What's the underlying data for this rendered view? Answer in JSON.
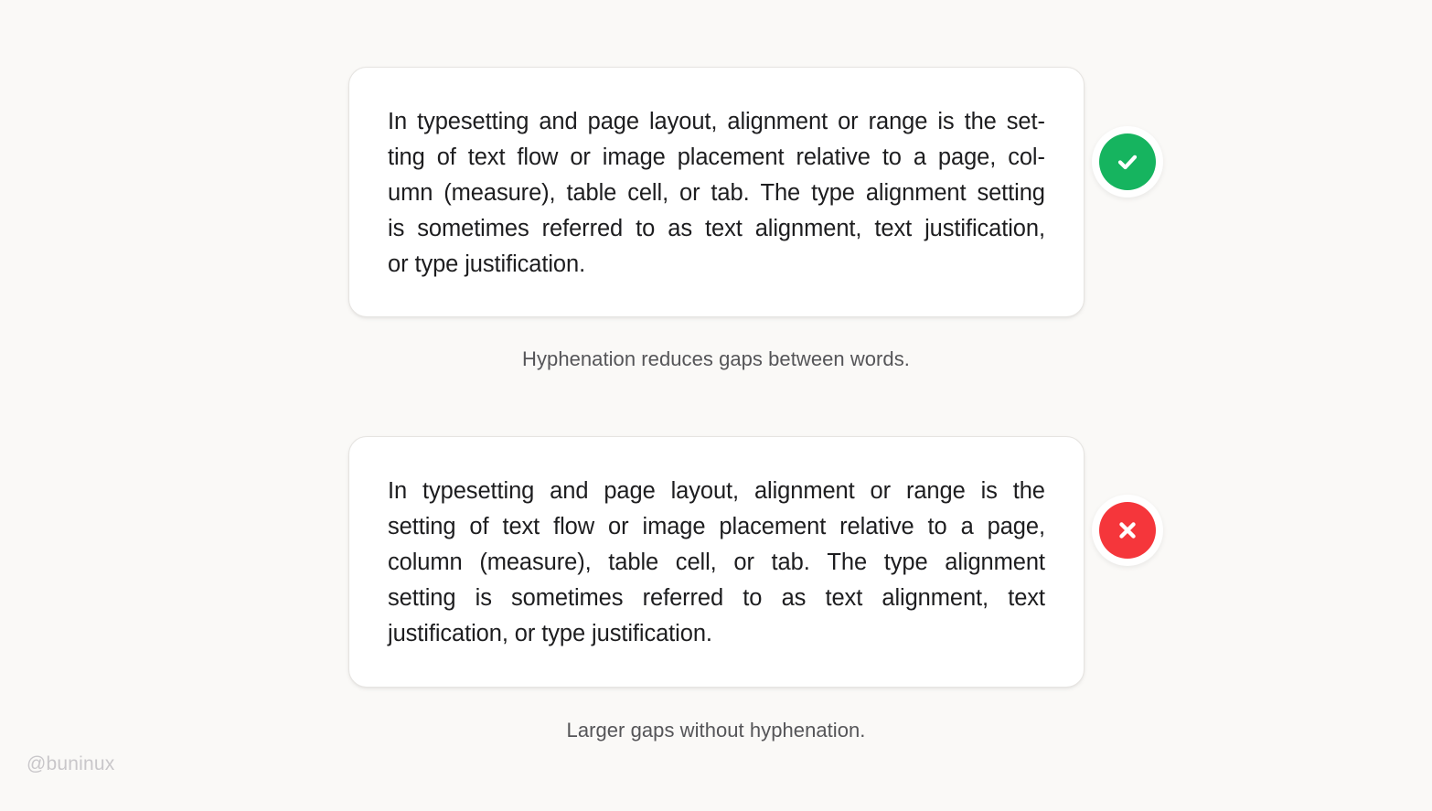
{
  "background_color": "#faf9f7",
  "examples": [
    {
      "id": "hyphenated",
      "badge": {
        "icon": "check-circle-icon",
        "color": "#16b45f",
        "ring_color": "#ffffff"
      },
      "card": {
        "text": "In typesetting and page layout, alignment or range is the setting of text flow or image placement relative to a page, column (measure), table cell, or tab. The type alignment setting is sometimes referred to as text alignment, text justification, or type justification.",
        "alignment": "justify",
        "hyphenation": "auto",
        "lines": [
          "In typesetting and page layout, alignment or range is the set-",
          "ting of text flow or image placement relative to a page, col-",
          "umn (measure), table cell, or tab. The type alignment setting",
          "is sometimes referred to as text alignment, text justification,",
          "or type justification."
        ],
        "line_words": [
          [
            "In",
            "typesetting",
            "and",
            "page",
            "layout,",
            "alignment",
            "or",
            "range",
            "is",
            "the",
            "set-"
          ],
          [
            "ting",
            "of",
            "text",
            "flow",
            "or",
            "image",
            "placement",
            "relative",
            "to",
            "a",
            "page,",
            "col-"
          ],
          [
            "umn",
            "(measure),",
            "table",
            "cell,",
            "or",
            "tab.",
            "The",
            "type",
            "alignment",
            "setting"
          ],
          [
            "is",
            "sometimes",
            "referred",
            "to",
            "as",
            "text",
            "alignment,",
            "text",
            "justification,"
          ],
          [
            "or type justification."
          ]
        ]
      },
      "caption": "Hyphenation reduces gaps between words."
    },
    {
      "id": "not-hyphenated",
      "badge": {
        "icon": "x-circle-icon",
        "color": "#f5363b",
        "ring_color": "#ffffff"
      },
      "card": {
        "text": "In typesetting and page layout, alignment or range is the setting of text flow or image placement relative to a page, column (measure), table cell, or tab. The type alignment setting is sometimes referred to as text alignment, text justification, or type justification.",
        "alignment": "justify",
        "hyphenation": "none",
        "lines": [
          "In typesetting and page layout, alignment or range is the",
          "setting of text flow or image placement relative to a page,",
          "column (measure), table cell, or tab. The type alignment",
          "setting is sometimes referred to as text alignment, text",
          "justification, or type justification."
        ],
        "line_words": [
          [
            "In",
            "typesetting",
            "and",
            "page",
            "layout,",
            "alignment",
            "or",
            "range",
            "is",
            "the"
          ],
          [
            "setting",
            "of",
            "text",
            "flow",
            "or",
            "image",
            "placement",
            "relative",
            "to",
            "a",
            "page,"
          ],
          [
            "column",
            "(measure),",
            "table",
            "cell,",
            "or",
            "tab.",
            "The",
            "type",
            "alignment"
          ],
          [
            "setting",
            "is",
            "sometimes",
            "referred",
            "to",
            "as",
            "text",
            "alignment,",
            "text"
          ],
          [
            "justification, or type justification."
          ]
        ]
      },
      "caption": "Larger gaps without hyphenation."
    }
  ],
  "watermark": "@buninux"
}
